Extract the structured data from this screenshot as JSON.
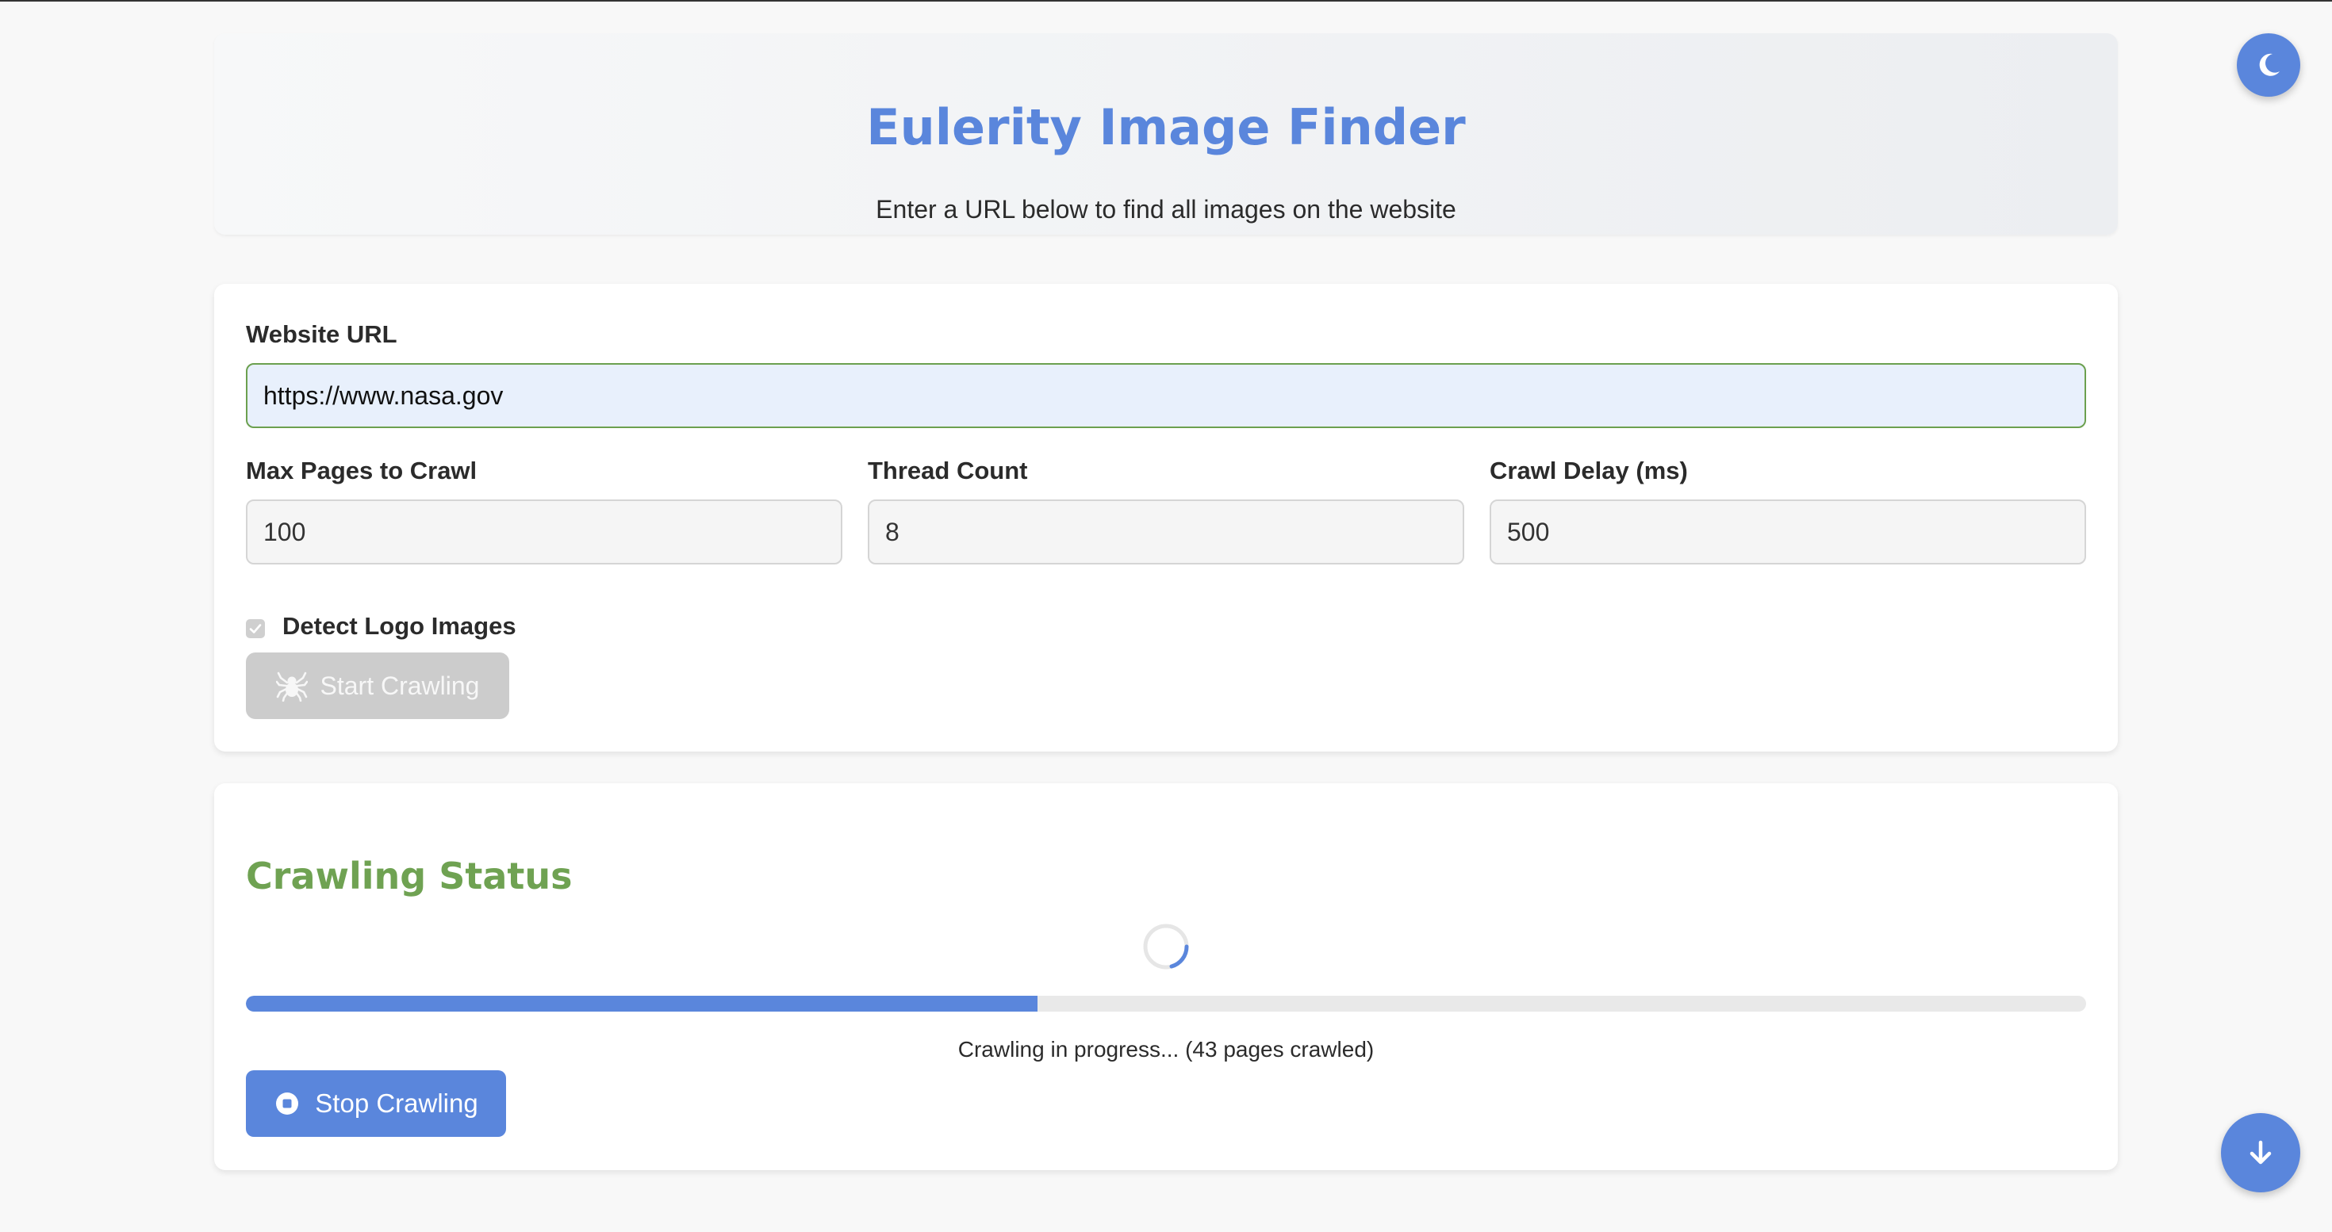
{
  "header": {
    "title": "Eulerity Image Finder",
    "subtitle": "Enter a URL below to find all images on the website"
  },
  "form": {
    "url_label": "Website URL",
    "url_value": "https://www.nasa.gov",
    "max_pages_label": "Max Pages to Crawl",
    "max_pages_value": "100",
    "thread_count_label": "Thread Count",
    "thread_count_value": "8",
    "crawl_delay_label": "Crawl Delay (ms)",
    "crawl_delay_value": "500",
    "detect_logo_label": "Detect Logo Images",
    "detect_logo_checked": true,
    "start_button_label": "Start Crawling",
    "start_button_icon": "spider-icon",
    "start_button_disabled": true
  },
  "status": {
    "title": "Crawling Status",
    "spinner_icon": "loading-spinner-icon",
    "progress_fraction": 0.43,
    "message": "Crawling in progress... (43 pages crawled)",
    "stop_button_label": "Stop Crawling",
    "stop_button_icon": "stop-icon"
  },
  "floating": {
    "theme_toggle_icon": "moon-icon",
    "scroll_button_icon": "arrow-down-icon"
  },
  "colors": {
    "accent": "#5a86dc",
    "status_green": "#6fa252",
    "url_border": "#6ba04f",
    "disabled": "#cccccc"
  }
}
